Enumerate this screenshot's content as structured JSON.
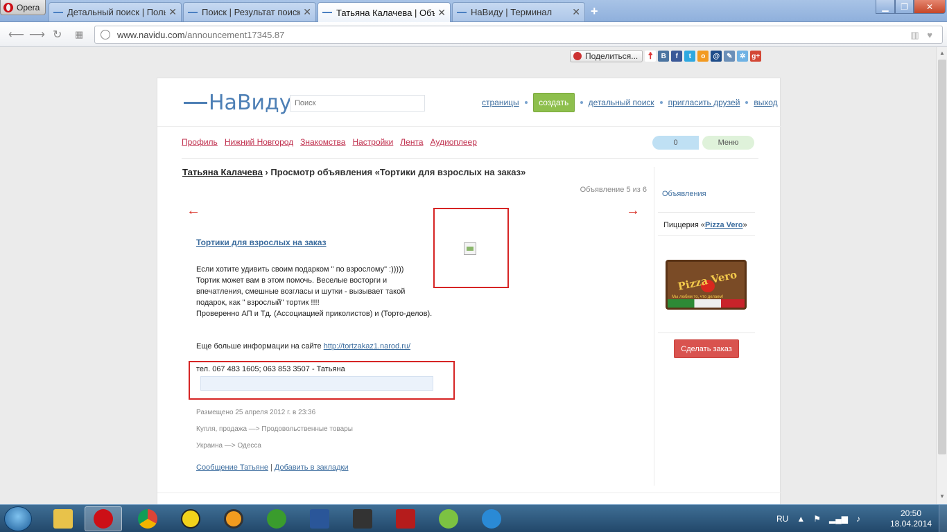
{
  "browser": {
    "menu_label": "Opera",
    "tabs": [
      {
        "title": "Детальный поиск | Поль"
      },
      {
        "title": "Поиск | Результат поиска"
      },
      {
        "title": "Татьяна Калачева | Объяв"
      },
      {
        "title": "НаВиду | Терминал"
      }
    ],
    "active_tab": 2,
    "address": {
      "host": "www.navidu.com",
      "path": "/announcement17345.87"
    }
  },
  "share": {
    "label": "Поделиться..."
  },
  "site": {
    "logo": "НаВиду",
    "search_placeholder": "Поиск",
    "top_nav": {
      "pages": "страницы",
      "create": "создать",
      "detailed_search": "детальный поиск",
      "invite": "пригласить друзей",
      "logout": "выход"
    },
    "menu": [
      "Профиль",
      "Нижний Новгород",
      "Знакомства",
      "Настройки",
      "Лента",
      "Аудиоплеер"
    ],
    "counter": "0",
    "menu_button": "Меню"
  },
  "announcement": {
    "author": "Татьяна Калачева",
    "breadcrumb_rest": " › Просмотр объявления «Тортики для взрослых на заказ»",
    "position": "Объявление 5 из 6",
    "prev_arrow": "←",
    "next_arrow": "→",
    "title": "Тортики для взрослых на заказ",
    "body": [
      "Если хотите удивить своим подарком \" по взрослому\" :)))))",
      "Тортик может вам в этом помочь. Веселые восторги и",
      "впечатления, смешные возгласы и шутки - вызывает такой",
      "подарок, как \" взрослый\" тортик !!!!",
      "Проверенно АП и Тд. (Ассоциацией приколистов) и (Торто-делов)."
    ],
    "more_text": "Еще больше информации на сайте ",
    "more_link": "http://tortzakaz1.narod.ru/",
    "phone": "тел. 067 483 1605; 063 853 3507 - Татьяна",
    "posted": "Размещено 25 апреля 2012 г. в 23:36",
    "category": "Купля, продажа —> Продовольственные товары",
    "location": "Украина —> Одесса",
    "message_link": "Сообщение Татьяне",
    "separator": " | ",
    "bookmark_link": "Добавить в закладки"
  },
  "sidebar": {
    "ads_link": "Объявления",
    "pizza_prefix": "Пиццерия «",
    "pizza_name": "Pizza Vero",
    "pizza_suffix": "»",
    "pizza_logo_text": "Pizza Vero",
    "pizza_logo_sub": "Мы любим то, что делаем!",
    "order_button": "Сделать заказ"
  },
  "taskbar": {
    "lang": "RU",
    "time": "20:50",
    "date": "18.04.2014"
  },
  "colors": {
    "accent": "#4d7fb5",
    "menu_link": "#c0304e",
    "highlight_border": "#d62424",
    "create_button": "#8ebf4d",
    "order_button": "#d9534f"
  }
}
